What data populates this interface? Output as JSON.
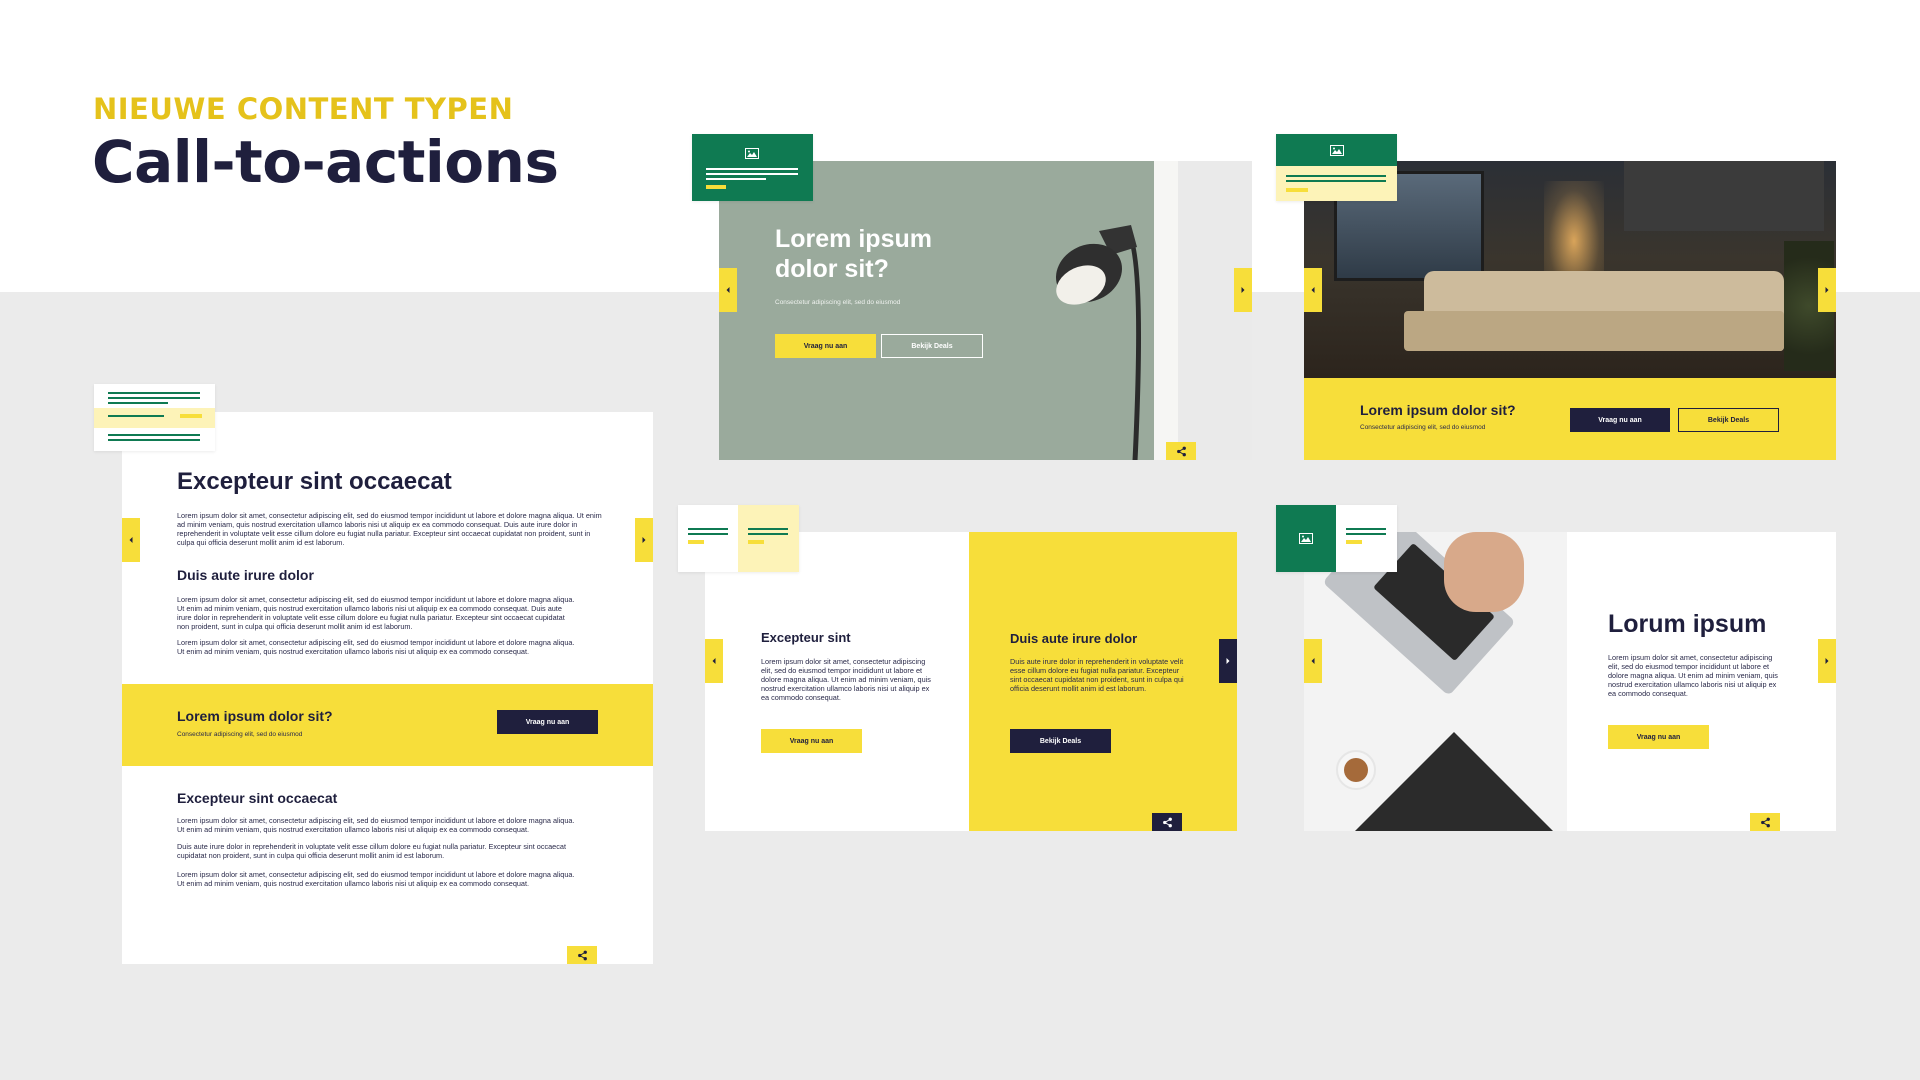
{
  "header": {
    "eyebrow": "NIEUWE CONTENT TYPEN",
    "title": "Call-to-actions"
  },
  "colors": {
    "yellow": "#f7de3a",
    "navy": "#1f1f3d",
    "green": "#0f7a52",
    "pale_yellow": "#fdf3b8",
    "sage": "#9aaa9c"
  },
  "card_lamp": {
    "heading_line1": "Lorem ipsum",
    "heading_line2": "dolor sit?",
    "subtitle": "Consectetur adipiscing elit, sed do eiusmod",
    "primary_button": "Vraag nu aan",
    "secondary_button": "Bekijk Deals",
    "thumbnail_icon": "image-icon"
  },
  "card_sofa": {
    "heading": "Lorem ipsum dolor sit?",
    "subtitle": "Consectetur adipiscing elit, sed do eiusmod",
    "primary_button": "Vraag nu aan",
    "secondary_button": "Bekijk Deals",
    "thumbnail_icon": "image-icon"
  },
  "card_article": {
    "heading": "Excepteur sint occaecat",
    "para1": "Lorem ipsum dolor sit amet, consectetur adipiscing elit, sed do eiusmod tempor incididunt ut labore et dolore magna aliqua. Ut enim ad minim veniam, quis nostrud exercitation ullamco laboris nisi ut aliquip ex ea commodo consequat. Duis aute irure dolor in reprehenderit in voluptate velit esse cillum dolore eu fugiat nulla pariatur. Excepteur sint occaecat cupidatat non proident, sunt in culpa qui officia deserunt mollit anim id est laborum.",
    "subheading": "Duis aute irure dolor",
    "para2": "Lorem ipsum dolor sit amet, consectetur adipiscing elit, sed do eiusmod tempor incididunt ut labore et dolore magna aliqua. Ut enim ad minim veniam, quis nostrud exercitation ullamco laboris nisi ut aliquip ex ea commodo consequat. Duis aute irure dolor in reprehenderit in voluptate velit esse cillum dolore eu fugiat nulla pariatur. Excepteur sint occaecat cupidatat non proident, sunt in culpa qui officia deserunt mollit anim id est laborum.",
    "para3": "Lorem ipsum dolor sit amet, consectetur adipiscing elit, sed do eiusmod tempor incididunt ut labore et dolore magna aliqua. Ut enim ad minim veniam, quis nostrud exercitation ullamco laboris nisi ut aliquip ex ea commodo consequat.",
    "cta_heading": "Lorem ipsum dolor sit?",
    "cta_subtitle": "Consectetur adipiscing elit, sed do eiusmod",
    "cta_button": "Vraag nu aan",
    "heading2": "Excepteur sint occaecat",
    "para4": "Lorem ipsum dolor sit amet, consectetur adipiscing elit, sed do eiusmod tempor incididunt ut labore et dolore magna aliqua. Ut enim ad minim veniam, quis nostrud exercitation ullamco laboris nisi ut aliquip ex ea commodo consequat.",
    "para5": "Duis aute irure dolor in reprehenderit in voluptate velit esse cillum dolore eu fugiat nulla pariatur. Excepteur sint occaecat cupidatat non proident, sunt in culpa qui officia deserunt mollit anim id est laborum.",
    "para6": "Lorem ipsum dolor sit amet, consectetur adipiscing elit, sed do eiusmod tempor incididunt ut labore et dolore magna aliqua. Ut enim ad minim veniam, quis nostrud exercitation ullamco laboris nisi ut aliquip ex ea commodo consequat."
  },
  "card_split": {
    "left_heading": "Excepteur sint",
    "left_text": "Lorem ipsum dolor sit amet, consectetur adipiscing elit, sed do eiusmod tempor incididunt ut labore et dolore magna aliqua. Ut enim ad minim veniam, quis nostrud exercitation ullamco laboris nisi ut aliquip ex ea commodo consequat.",
    "left_button": "Vraag nu aan",
    "right_heading": "Duis aute irure dolor",
    "right_text": "Duis aute irure dolor in reprehenderit in voluptate velit esse cillum dolore eu fugiat nulla pariatur. Excepteur sint occaecat cupidatat non proident, sunt in culpa qui officia deserunt mollit anim id est laborum.",
    "right_button": "Bekijk Deals"
  },
  "card_laptop": {
    "heading": "Lorum ipsum",
    "text": "Lorem ipsum dolor sit amet, consectetur adipiscing elit, sed do eiusmod tempor incididunt ut labore et dolore magna aliqua. Ut enim ad minim veniam, quis nostrud exercitation ullamco laboris nisi ut aliquip ex ea commodo consequat.",
    "button": "Vraag nu aan",
    "thumbnail_icon": "image-icon"
  },
  "icons": {
    "arrow_left": "chevron-left-icon",
    "arrow_right": "chevron-right-icon",
    "share": "share-icon"
  }
}
